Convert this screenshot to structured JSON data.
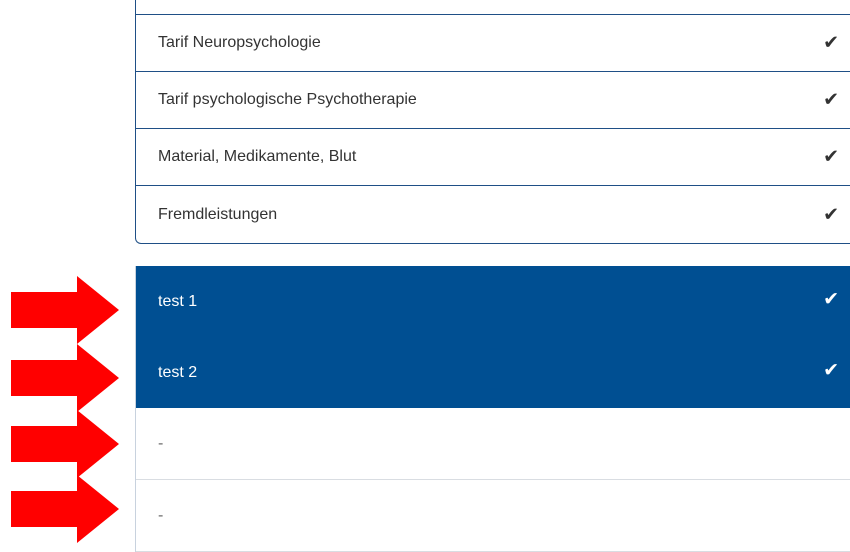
{
  "top_list": [
    {
      "label": "Tarif Neuropsychologie",
      "checked": true
    },
    {
      "label": "Tarif psychologische Psychotherapie",
      "checked": true
    },
    {
      "label": "Material, Medikamente, Blut",
      "checked": true
    },
    {
      "label": "Fremdleistungen",
      "checked": true
    }
  ],
  "bottom_list": [
    {
      "label": "test 1",
      "selected": true,
      "checked": true
    },
    {
      "label": "test 2",
      "selected": true,
      "checked": true
    },
    {
      "label": "-",
      "selected": false,
      "checked": false
    },
    {
      "label": "-",
      "selected": false,
      "checked": false
    }
  ],
  "check_glyph": "✔",
  "colors": {
    "selected_bg": "#004f92",
    "border": "#1f4f86",
    "arrow": "#ff0000"
  },
  "annotation_arrows": {
    "count": 4,
    "icon": "red-arrow-right-icon"
  }
}
